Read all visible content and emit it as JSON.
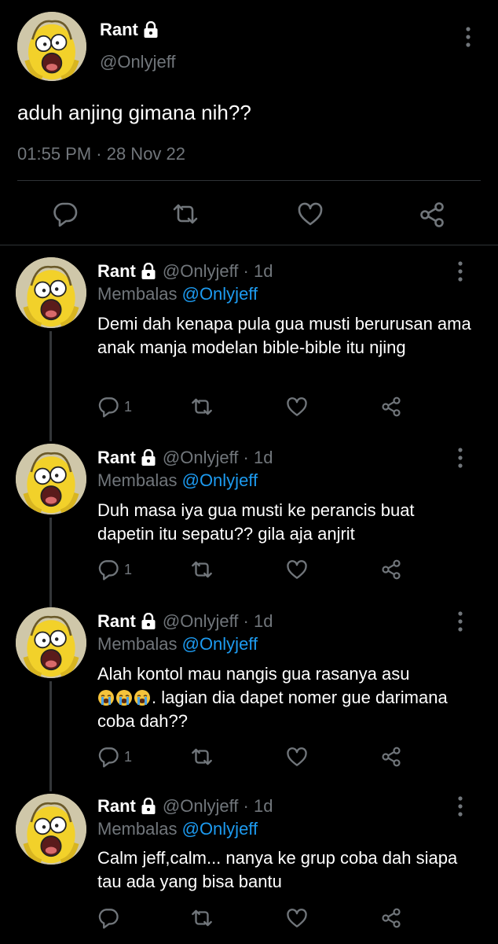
{
  "main_tweet": {
    "display_name": "Rant",
    "handle": "@Onlyjeff",
    "text": "aduh anjing gimana nih??",
    "timestamp": "01:55 PM · 28 Nov 22",
    "icons": [
      "lock-icon",
      "more-vertical-icon",
      "reply-icon",
      "retweet-icon",
      "like-icon",
      "share-icon"
    ]
  },
  "replies": [
    {
      "display_name": "Rant",
      "handle_time": "@Onlyjeff · 1d",
      "replying_label": "Membalas",
      "replying_to": "@Onlyjeff",
      "text": "Demi dah kenapa pula gua musti berurusan ama anak manja modelan bible-bible itu njing",
      "reply_count": "1"
    },
    {
      "display_name": "Rant",
      "handle_time": "@Onlyjeff · 1d",
      "replying_label": "Membalas",
      "replying_to": "@Onlyjeff",
      "text": "Duh masa iya gua musti ke perancis buat dapetin itu sepatu?? gila aja anjrit",
      "reply_count": "1"
    },
    {
      "display_name": "Rant",
      "handle_time": "@Onlyjeff · 1d",
      "replying_label": "Membalas",
      "replying_to": "@Onlyjeff",
      "text_before_emoji": "Alah kontol mau nangis gua rasanya asu",
      "emoji": "😭😭😭",
      "text_after_emoji": ". lagian dia dapet nomer gue darimana coba dah??",
      "reply_count": "1"
    },
    {
      "display_name": "Rant",
      "handle_time": "@Onlyjeff · 1d",
      "replying_label": "Membalas",
      "replying_to": "@Onlyjeff",
      "text": "Calm jeff,calm... nanya ke grup coba dah siapa tau ada yang bisa bantu",
      "reply_count": ""
    }
  ],
  "colors": {
    "background": "#000000",
    "text_primary": "#ffffff",
    "text_secondary": "#71767b",
    "link": "#1d9bf0",
    "divider": "#2f3336"
  }
}
